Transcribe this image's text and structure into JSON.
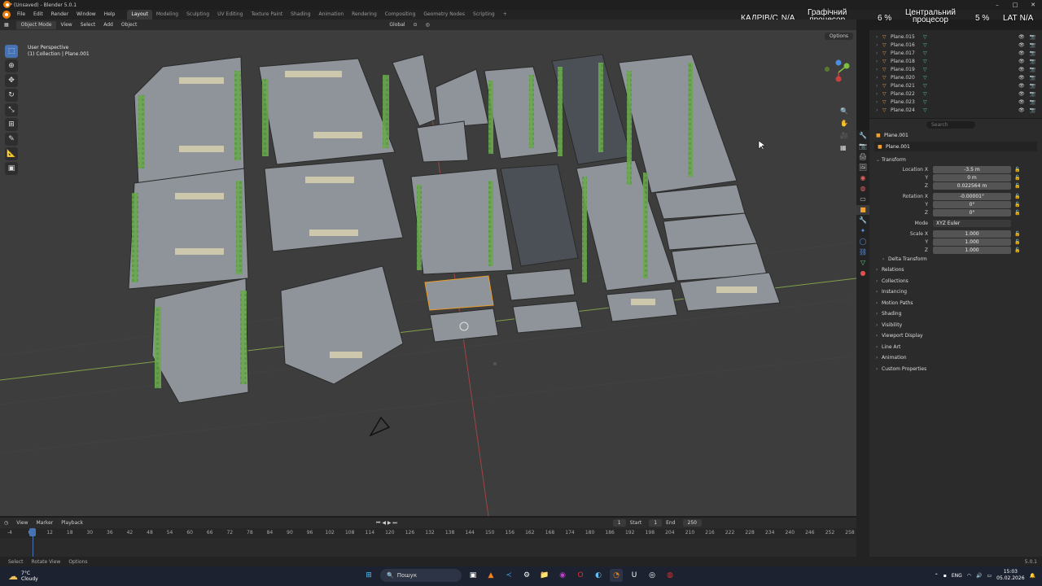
{
  "window": {
    "title": "* (Unsaved) - Blender 5.0.1"
  },
  "menu": [
    "File",
    "Edit",
    "Render",
    "Window",
    "Help"
  ],
  "workspaces": [
    "Layout",
    "Modeling",
    "Sculpting",
    "UV Editing",
    "Texture Paint",
    "Shading",
    "Animation",
    "Rendering",
    "Compositing",
    "Geometry Nodes",
    "Scripting"
  ],
  "hud": {
    "fps_label": "КАДРІВ/С",
    "fps_value": "N/A",
    "gpu_label1": "Графічний",
    "gpu_label2": "процесор",
    "gpu_value": "6 %",
    "cpu_label1": "Центральний",
    "cpu_label2": "процесор",
    "cpu_value": "5 %",
    "lat_label": "LAT",
    "lat_value": "N/A",
    "view_layer": "ViewLayer"
  },
  "viewport_header": {
    "mode": "Object Mode",
    "menus": [
      "View",
      "Select",
      "Add",
      "Object"
    ],
    "transform_orientation": "Global",
    "options": "Options"
  },
  "viewport": {
    "perspective": "User Perspective",
    "collection": "(1) Collection | Plane.001"
  },
  "outliner": {
    "items": [
      "Plane.015",
      "Plane.016",
      "Plane.017",
      "Plane.018",
      "Plane.019",
      "Plane.020",
      "Plane.021",
      "Plane.022",
      "Plane.023",
      "Plane.024"
    ]
  },
  "properties": {
    "search_placeholder": "Search",
    "object_name": "Plane.001",
    "object_data": "Plane.001",
    "transform_title": "Transform",
    "location_label": "Location X",
    "location": [
      "-3.5 m",
      "0 m",
      "0.022564 m"
    ],
    "rotation_label": "Rotation X",
    "rotation": [
      "-0.00001°",
      "0°",
      "0°"
    ],
    "mode_label": "Mode",
    "mode_value": "XYZ Euler",
    "scale_label": "Scale X",
    "scale": [
      "1.000",
      "1.000",
      "1.000"
    ],
    "axis_labels": [
      "Y",
      "Z"
    ],
    "delta_transform": "Delta Transform",
    "sections": [
      "Relations",
      "Collections",
      "Instancing",
      "Motion Paths",
      "Shading",
      "Visibility",
      "Viewport Display",
      "Line Art",
      "Animation",
      "Custom Properties"
    ]
  },
  "timeline": {
    "menus": [
      "View",
      "Marker",
      "Playback"
    ],
    "current_frame": "1",
    "start_label": "Start",
    "start": "1",
    "end_label": "End",
    "end": "250",
    "frame_ticks": [
      "-4",
      "6",
      "12",
      "18",
      "30",
      "36",
      "42",
      "48",
      "54",
      "60",
      "66",
      "72",
      "78",
      "84",
      "90",
      "96",
      "102",
      "108",
      "114",
      "120",
      "126",
      "132",
      "138",
      "144",
      "150",
      "156",
      "162",
      "168",
      "174",
      "180",
      "186",
      "192",
      "198",
      "204",
      "210",
      "216",
      "222",
      "228",
      "234",
      "240",
      "246",
      "252",
      "258"
    ]
  },
  "statusbar": {
    "select": "Select",
    "rotate": "Rotate View",
    "options": "Options",
    "version": "5.0.1"
  },
  "taskbar": {
    "weather_temp": "7°C",
    "weather_desc": "Cloudy",
    "search": "Пошук",
    "lang": "ENG",
    "time": "15:03",
    "date": "05.02.2026"
  }
}
